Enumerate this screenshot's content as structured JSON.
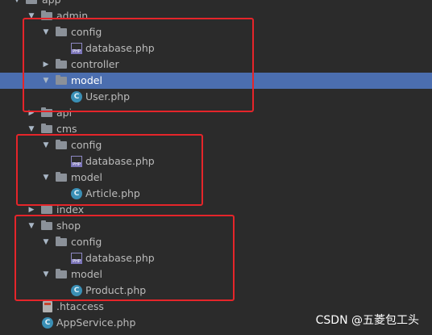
{
  "tree": {
    "app": "app",
    "admin": "admin",
    "admin_config": "config",
    "admin_config_db": "database.php",
    "controller": "controller",
    "admin_model": "model",
    "user_php": "User.php",
    "api": "api",
    "cms": "cms",
    "cms_config": "config",
    "cms_config_db": "database.php",
    "cms_model": "model",
    "article_php": "Article.php",
    "index": "index",
    "shop": "shop",
    "shop_config": "config",
    "shop_config_db": "database.php",
    "shop_model": "model",
    "product_php": "Product.php",
    "htaccess": ".htaccess",
    "appservice": "AppService.php"
  },
  "watermark": "CSDN @五菱包工头",
  "colors": {
    "background": "#2b2b2b",
    "selection": "#4b6eaf",
    "highlight_box": "#e5252a"
  }
}
